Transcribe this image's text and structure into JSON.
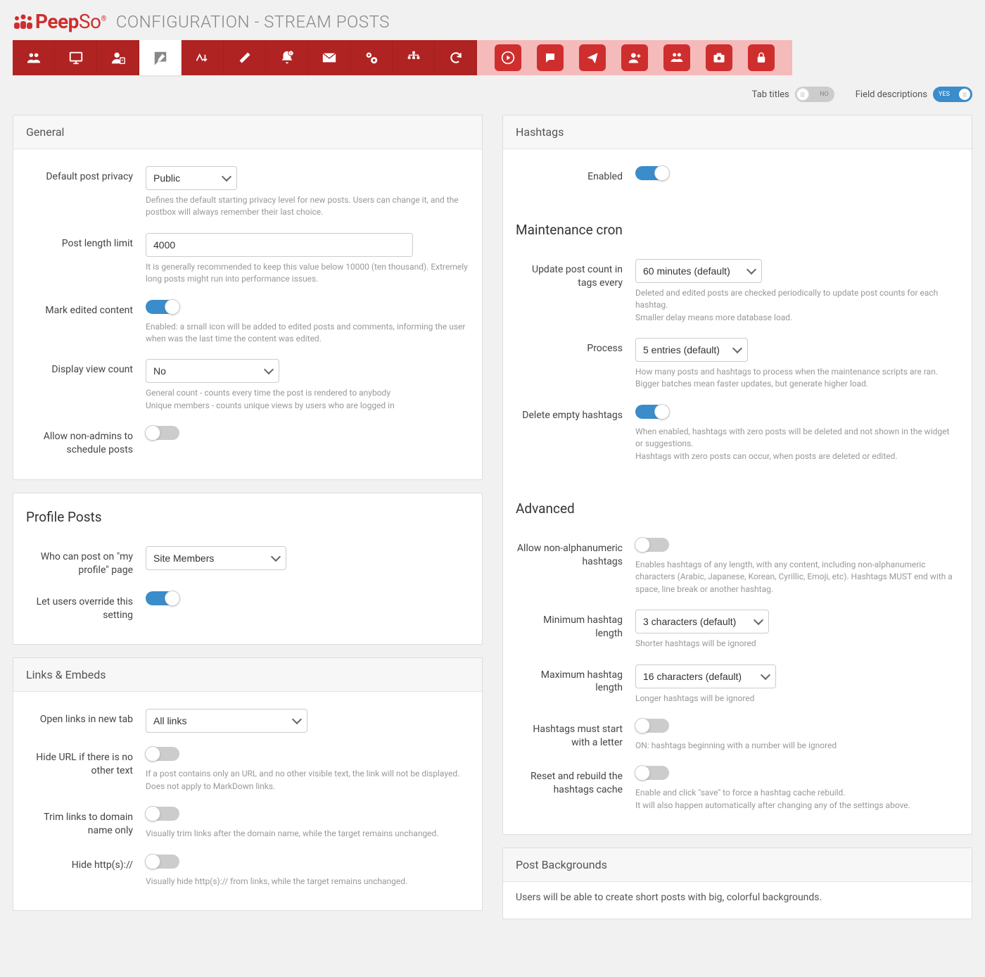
{
  "brand": "PeepSo",
  "page_title": "CONFIGURATION - STREAM POSTS",
  "topright": {
    "tab_titles_label": "Tab titles",
    "tab_titles_value": "NO",
    "field_desc_label": "Field descriptions",
    "field_desc_value": "YES"
  },
  "left": {
    "general": {
      "title": "General",
      "default_privacy": {
        "label": "Default post privacy",
        "value": "Public",
        "desc": "Defines the default starting privacy level for new posts. Users can change it, and the postbox will always remember their last choice."
      },
      "post_length": {
        "label": "Post length limit",
        "value": "4000",
        "desc": "It is generally recommended to keep this value below 10000 (ten thousand). Extremely long posts might run into performance issues."
      },
      "mark_edited": {
        "label": "Mark edited content",
        "on": true,
        "desc": "Enabled: a small icon will be added to edited posts and comments, informing the user when was the last time the content was edited."
      },
      "view_count": {
        "label": "Display view count",
        "value": "No",
        "desc": "General count - counts every time the post is rendered to anybody\nUnique members - counts unique views by users who are logged in"
      },
      "allow_schedule": {
        "label": "Allow non-admins to schedule posts",
        "on": false
      }
    },
    "profile": {
      "title": "Profile Posts",
      "who_post": {
        "label": "Who can post on \"my profile\" page",
        "value": "Site Members"
      },
      "override": {
        "label": "Let users override this setting",
        "on": true
      }
    },
    "links": {
      "title": "Links & Embeds",
      "open_links": {
        "label": "Open links in new tab",
        "value": "All links"
      },
      "hide_url": {
        "label": "Hide URL if there is no other text",
        "on": false,
        "desc": "If a post contains only an URL and no other visible text, the link will not be displayed. Does not apply to MarkDown links."
      },
      "trim": {
        "label": "Trim links to domain name only",
        "on": false,
        "desc": "Visually trim links after the domain name, while the target remains unchanged."
      },
      "hide_http": {
        "label": "Hide http(s)://",
        "on": false,
        "desc": "Visually hide http(s):// from links, while the target remains unchanged."
      }
    }
  },
  "right": {
    "hashtags": {
      "title": "Hashtags",
      "enabled": {
        "label": "Enabled",
        "on": true
      },
      "maint_title": "Maintenance cron",
      "update_every": {
        "label": "Update post count in tags every",
        "value": "60 minutes (default)",
        "desc": "Deleted and edited posts are checked periodically to update post counts for each hashtag.\nSmaller delay means more database load."
      },
      "process": {
        "label": "Process",
        "value": "5 entries (default)",
        "desc": "How many posts and hashtags to process when the maintenance scripts are ran. Bigger batches mean faster updates, but generate higher load."
      },
      "delete_empty": {
        "label": "Delete empty hashtags",
        "on": true,
        "desc": "When enabled, hashtags with zero posts will be deleted and not shown in the widget or suggestions.\nHashtags with zero posts can occur, when posts are deleted or edited."
      },
      "adv_title": "Advanced",
      "allow_nonalpha": {
        "label": "Allow non-alphanumeric hashtags",
        "on": false,
        "desc": "Enables hashtags of any length, with any content, including non-alphanumeric characters (Arabic, Japanese, Korean, Cyrillic, Emoji, etc). Hashtags MUST end with a space, line break or another hashtag."
      },
      "min_len": {
        "label": "Minimum hashtag length",
        "value": "3 characters (default)",
        "desc": "Shorter hashtags will be ignored"
      },
      "max_len": {
        "label": "Maximum hashtag length",
        "value": "16 characters (default)",
        "desc": "Longer hashtags will be ignored"
      },
      "start_letter": {
        "label": "Hashtags must start with a letter",
        "on": false,
        "desc": "ON: hashtags beginning with a number will be ignored"
      },
      "reset_cache": {
        "label": "Reset and rebuild the hashtags cache",
        "on": false,
        "desc": "Enable and click \"save\" to force a hashtag cache rebuild.\nIt will also happen automatically after changing any of the settings above."
      }
    },
    "backgrounds": {
      "title": "Post Backgrounds",
      "intro": "Users will be able to create short posts with big, colorful backgrounds."
    }
  }
}
